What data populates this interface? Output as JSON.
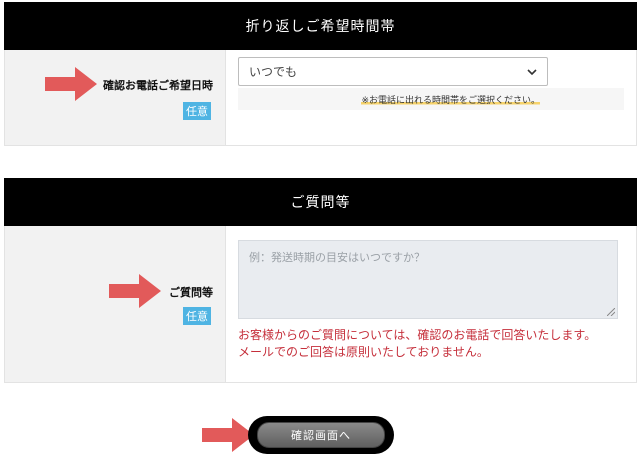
{
  "callback": {
    "header": "折り返しご希望時間帯",
    "label": "確認お電話ご希望日時",
    "badge": "任意",
    "select_value": "いつでも",
    "notice": "※お電話に出れる時間帯をご選択ください。"
  },
  "questions": {
    "header": "ご質問等",
    "label": "ご質問等",
    "badge": "任意",
    "placeholder": "例：発送時期の目安はいつですか？",
    "note_line1": "お客様からのご質問については、確認のお電話で回答いたします。",
    "note_line2": "メールでのご回答は原則いたしておりません。"
  },
  "confirm_button": "確認画面へ",
  "colors": {
    "header_bg": "#000000",
    "label_bg": "#f2f2f2",
    "badge": "#4fb4e3",
    "arrow": "#e25a5a",
    "red_text": "#c52e3a",
    "highlight": "#f6d36b"
  },
  "icons": [
    "arrow-right-icon",
    "chevron-down-icon",
    "resize-handle-icon"
  ]
}
